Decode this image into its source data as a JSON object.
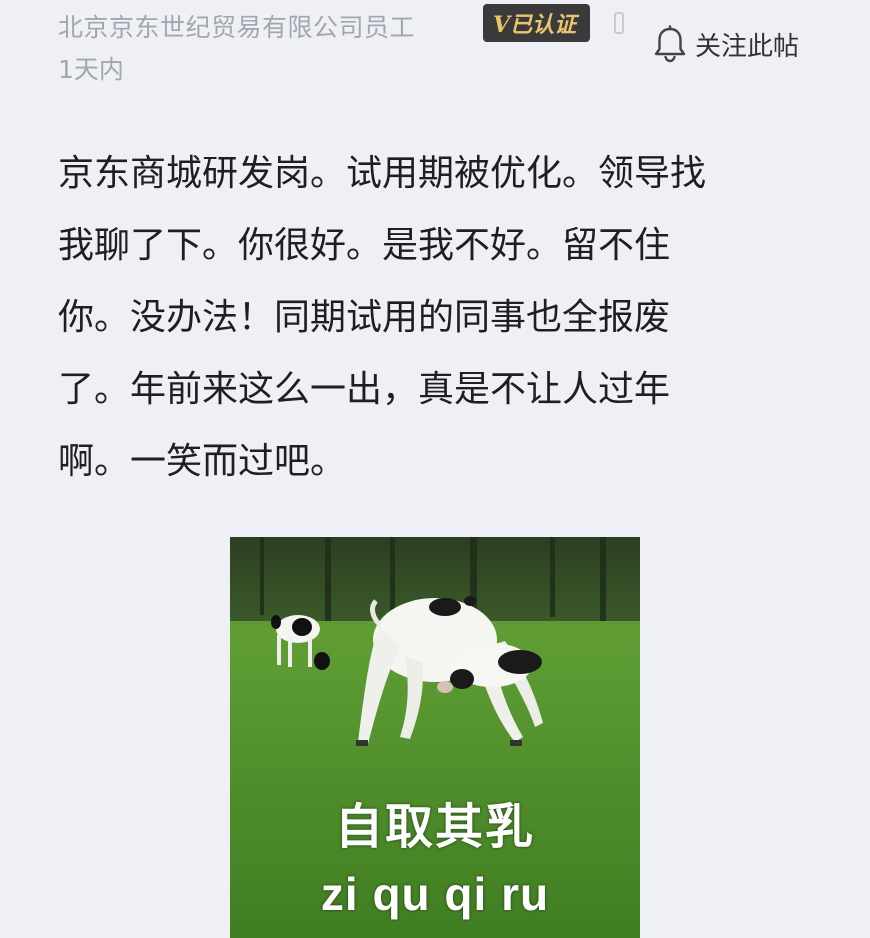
{
  "header": {
    "company": "北京京东世纪贸易有限公司员工",
    "badge": "V已认证",
    "time": "1天内",
    "follow_label": "关注此帖",
    "follow_icon": "bell-icon"
  },
  "post": {
    "lines": [
      "京东商城研发岗。试用期被优化。领导找",
      "我聊了下。你很好。是我不好。留不住",
      "你。没办法！同期试用的同事也全报废",
      "了。年前来这么一出，真是不让人过年",
      "啊。一笑而过吧。"
    ]
  },
  "meme": {
    "caption_cn": "自取其乳",
    "caption_pinyin": "zi qu qi ru"
  },
  "colors": {
    "background": "#eef0f6",
    "meta_text": "#a3a6ad",
    "badge_bg": "#3a3a3a",
    "badge_text": "#e9c56c",
    "body_text": "#1f1f1f"
  }
}
